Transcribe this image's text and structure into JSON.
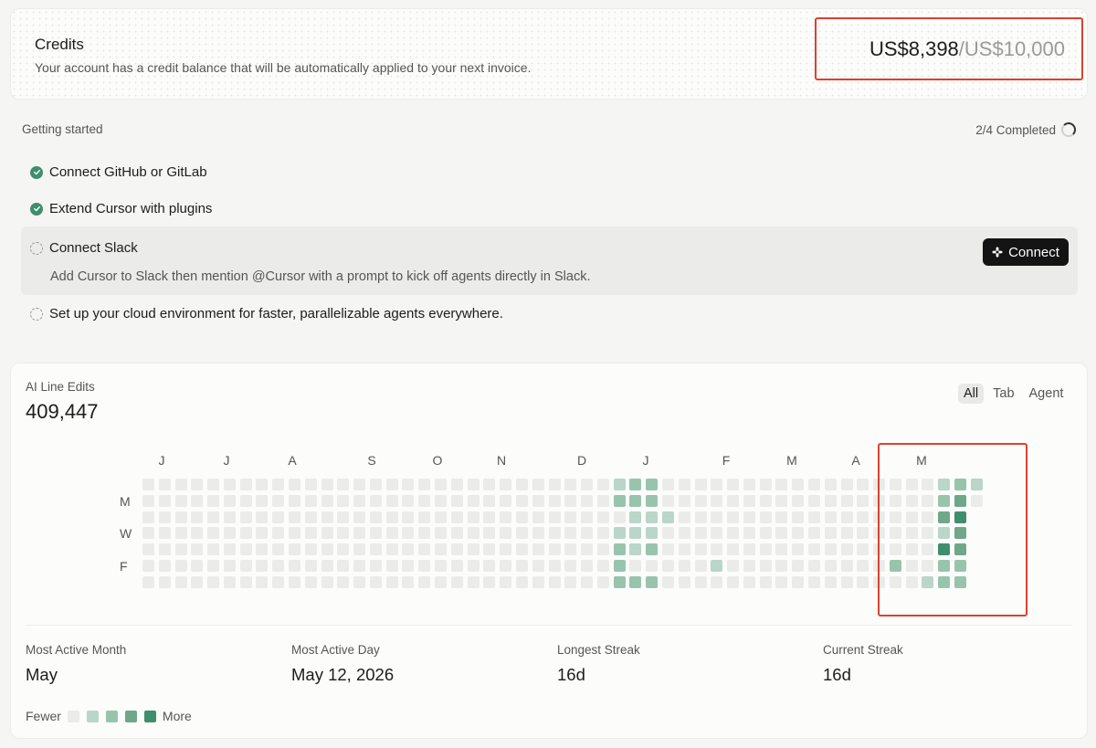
{
  "credits": {
    "title": "Credits",
    "subtitle": "Your account has a credit balance that will be automatically applied to your next invoice.",
    "used": "US$8,398",
    "total": "/US$10,000"
  },
  "getting_started": {
    "label": "Getting started",
    "progress": "2/4 Completed",
    "tasks": [
      {
        "label": "Connect GitHub or GitLab",
        "done": true
      },
      {
        "label": "Extend Cursor with plugins",
        "done": true
      },
      {
        "label": "Connect Slack",
        "done": false,
        "description": "Add Cursor to Slack then mention @Cursor with a prompt to kick off agents directly in Slack.",
        "button": "Connect"
      },
      {
        "label": "Set up your cloud environment for faster, parallelizable agents everywhere.",
        "done": false
      }
    ]
  },
  "edits": {
    "label": "AI Line Edits",
    "value": "409,447",
    "filters": [
      "All",
      "Tab",
      "Agent"
    ],
    "active_filter": "All",
    "months": [
      "J",
      "J",
      "A",
      "S",
      "O",
      "N",
      "D",
      "J",
      "F",
      "M",
      "A",
      "M"
    ],
    "day_labels": [
      "M",
      "W",
      "F"
    ],
    "colors": [
      "#ebebea",
      "#b9d6c8",
      "#98c4ad",
      "#6ea78a",
      "#3f8e6d"
    ],
    "activity_levels": {
      "29": [
        1,
        2,
        0,
        1,
        2,
        2,
        2
      ],
      "30": [
        2,
        2,
        1,
        1,
        1,
        0,
        2
      ],
      "31": [
        2,
        2,
        1,
        1,
        2,
        0,
        2
      ],
      "32": [
        0,
        0,
        1,
        0,
        0,
        0,
        0
      ],
      "35": [
        0,
        0,
        0,
        0,
        0,
        1,
        0
      ],
      "46": [
        0,
        0,
        0,
        0,
        0,
        2,
        0
      ],
      "48": [
        0,
        0,
        0,
        0,
        0,
        0,
        1
      ],
      "49": [
        1,
        2,
        3,
        1,
        4,
        2,
        2
      ],
      "50": [
        2,
        3,
        4,
        3,
        3,
        2,
        2
      ],
      "51": [
        1,
        0
      ]
    },
    "stats": [
      {
        "label": "Most Active Month",
        "value": "May"
      },
      {
        "label": "Most Active Day",
        "value": "May 12, 2026"
      },
      {
        "label": "Longest Streak",
        "value": "16d"
      },
      {
        "label": "Current Streak",
        "value": "16d"
      }
    ],
    "legend_fewer": "Fewer",
    "legend_more": "More"
  }
}
